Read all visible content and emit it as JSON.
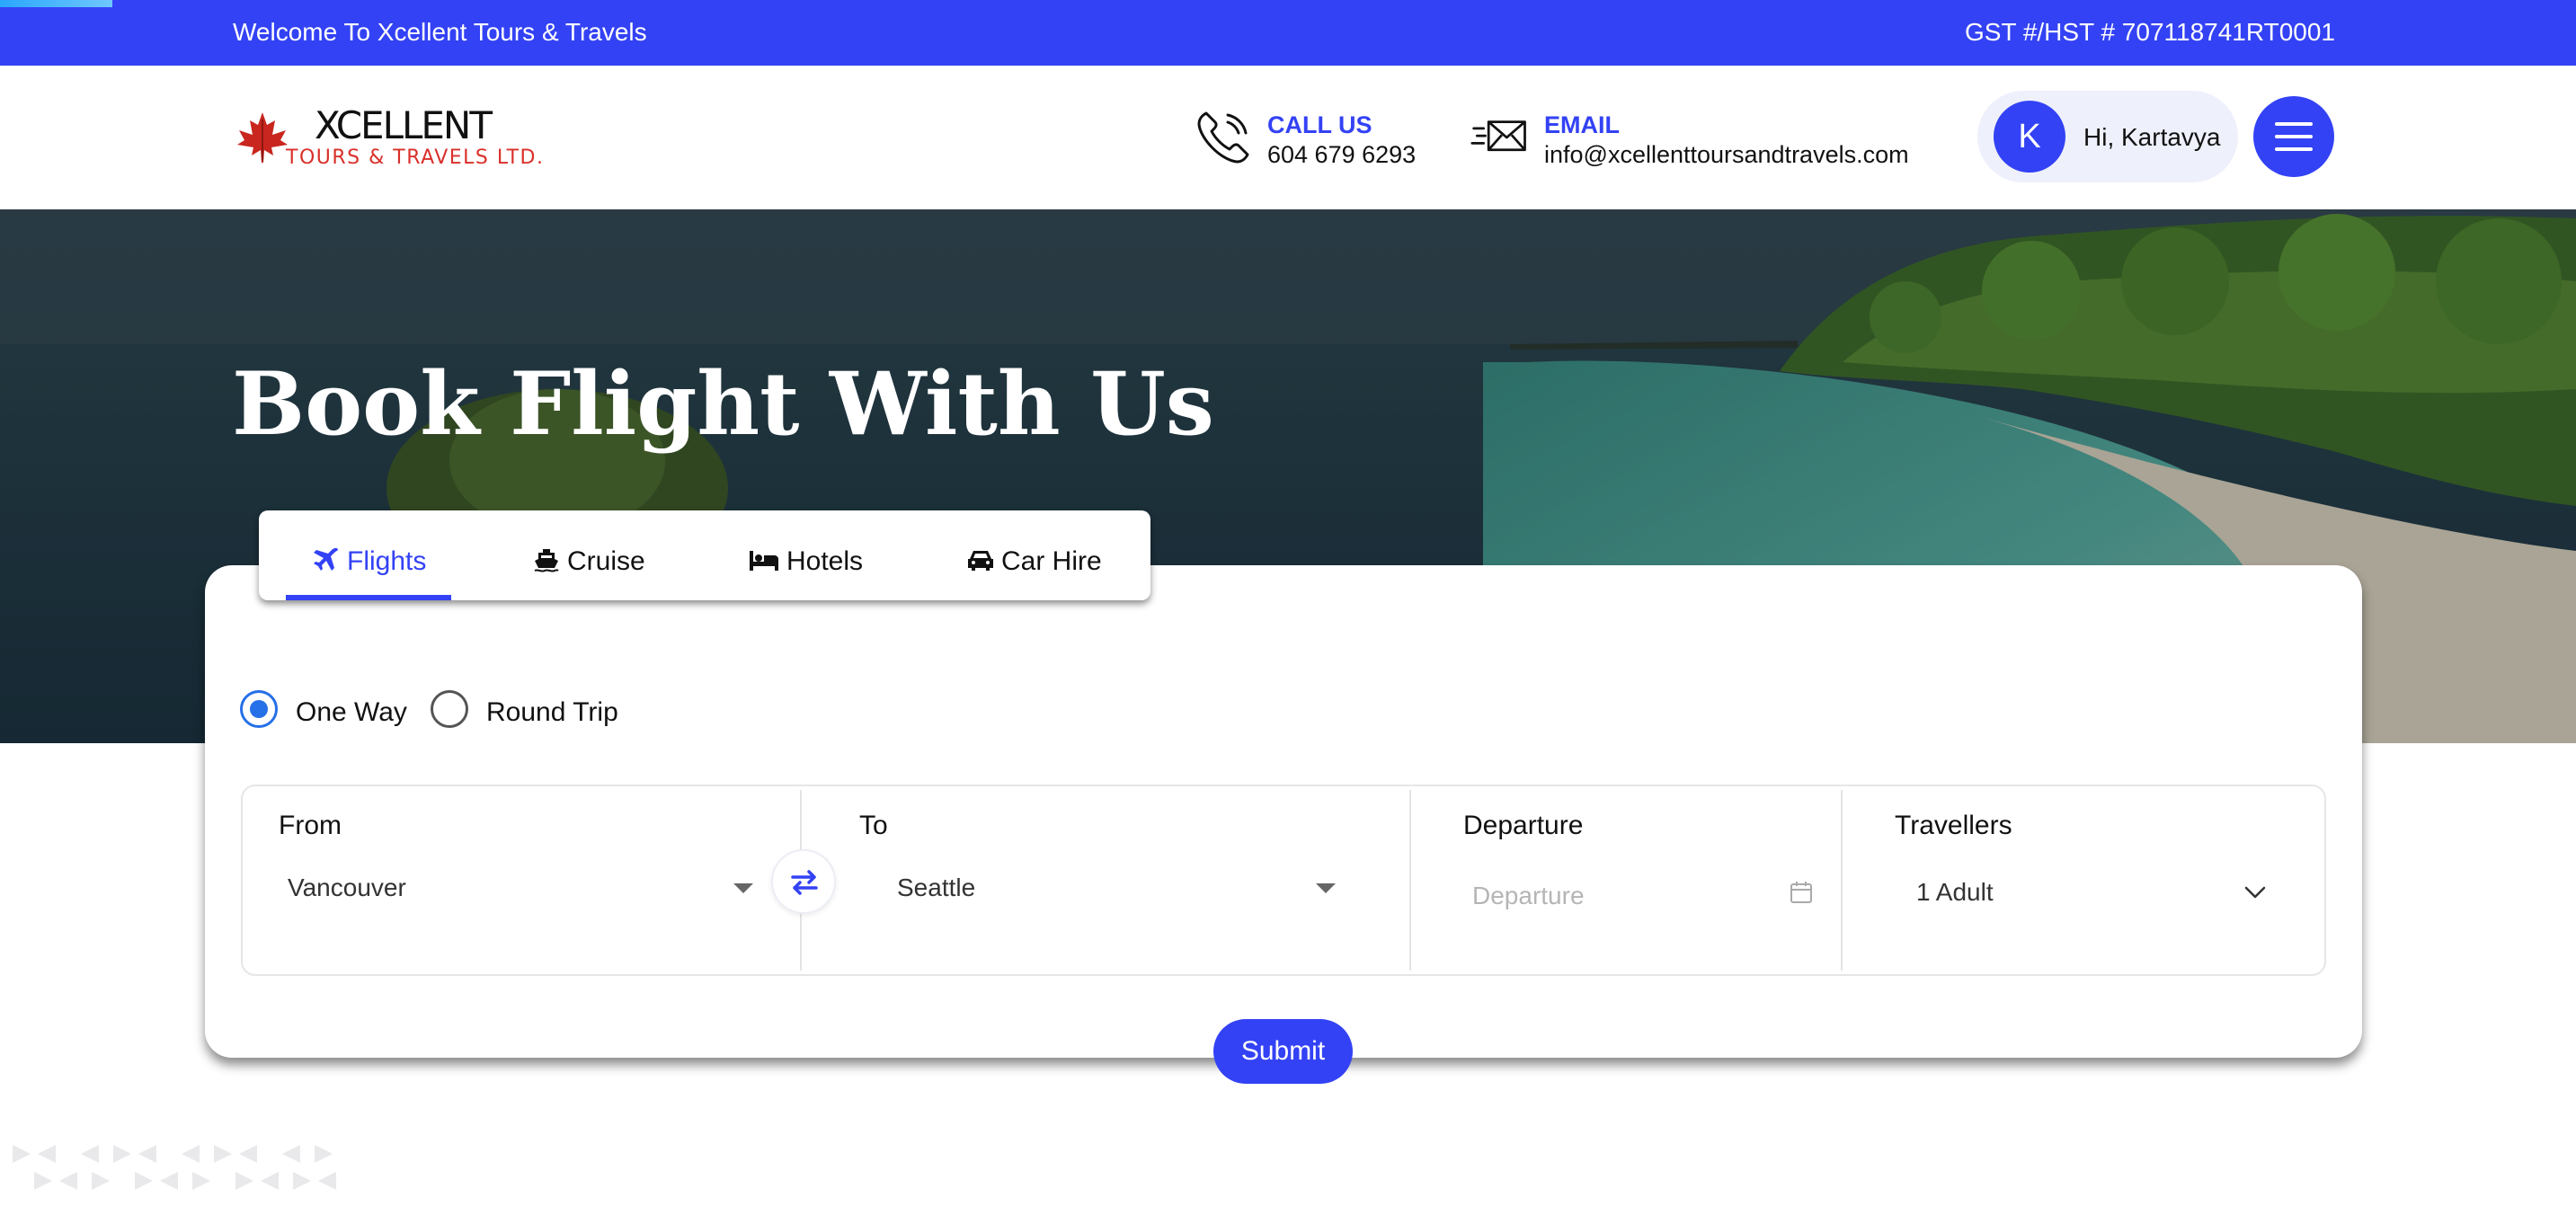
{
  "topbar": {
    "welcome": "Welcome To Xcellent Tours & Travels",
    "gst": "GST #/HST # 707118741RT0001",
    "color": "#3342f5"
  },
  "header": {
    "logo": {
      "brand_top": "XCELLENT",
      "brand_bottom": "TOURS & TRAVELS LTD."
    },
    "call": {
      "label": "CALL US",
      "value": "604 679 6293",
      "icon": "phone-icon"
    },
    "email": {
      "label": "EMAIL",
      "value": "info@xcellenttoursandtravels.com",
      "icon": "envelope-icon"
    },
    "user": {
      "initial": "K",
      "greeting": "Hi, Kartavya"
    },
    "menu_icon": "hamburger-icon"
  },
  "hero": {
    "title": "Book Flight With Us"
  },
  "booking": {
    "tabs": [
      {
        "label": "Flights",
        "icon": "plane-icon",
        "active": true
      },
      {
        "label": "Cruise",
        "icon": "ship-icon",
        "active": false
      },
      {
        "label": "Hotels",
        "icon": "bed-icon",
        "active": false
      },
      {
        "label": "Car Hire",
        "icon": "car-icon",
        "active": false
      }
    ],
    "trip_types": [
      {
        "label": "One Way",
        "selected": true
      },
      {
        "label": "Round Trip",
        "selected": false
      }
    ],
    "fields": {
      "from": {
        "label": "From",
        "value": "Vancouver"
      },
      "to": {
        "label": "To",
        "value": "Seattle"
      },
      "departure": {
        "label": "Departure",
        "placeholder": "Departure"
      },
      "travellers": {
        "label": "Travellers",
        "value": "1 Adult"
      }
    },
    "submit_label": "Submit"
  }
}
